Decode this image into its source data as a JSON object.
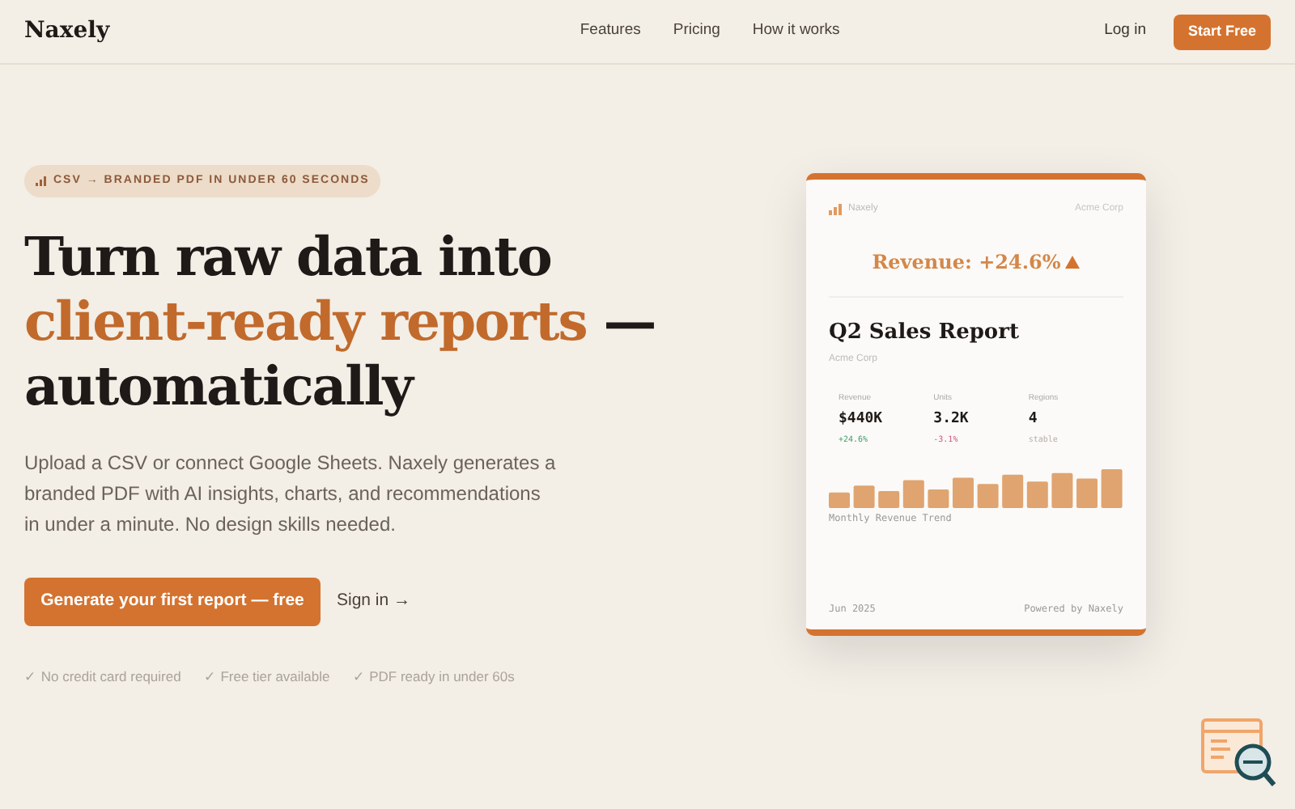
{
  "nav": {
    "brand": "Naxely",
    "links": [
      "Features",
      "Pricing",
      "How it works"
    ],
    "login": "Log in",
    "cta": "Start Free"
  },
  "hero": {
    "badge": "CSV → BRANDED PDF IN UNDER 60 SECONDS",
    "headline": [
      "Turn raw data into",
      "client-ready reports",
      " —",
      "automatically"
    ],
    "body": "Upload a CSV or connect Google Sheets. Naxely generates a branded PDF with AI insights, charts, and recommendations in under a minute. No design skills needed.",
    "primary": "Generate your first report — free",
    "secondary": "Sign in →",
    "perks": [
      "✓ No credit card required",
      "✓ Free tier available",
      "✓ PDF ready in under 60s"
    ]
  },
  "report": {
    "brand": "Naxely",
    "client": "Acme Corp",
    "highlight": "Revenue: +24.6%",
    "title": "Q2 Sales Report",
    "subtitle": "Acme Corp",
    "metrics": [
      {
        "label": "Revenue",
        "value": "$440K",
        "change": "+24.6%",
        "color": "#3f9a6a"
      },
      {
        "label": "Units",
        "value": "3.2K",
        "change": "-3.1%",
        "color": "#d0587a"
      },
      {
        "label": "Regions",
        "value": "4",
        "change": "stable",
        "color": "#b5b0a8"
      }
    ],
    "chart_caption": "Monthly Revenue Trend",
    "footer_left": "Jun 2025",
    "footer_right": "Powered by Naxely"
  }
}
